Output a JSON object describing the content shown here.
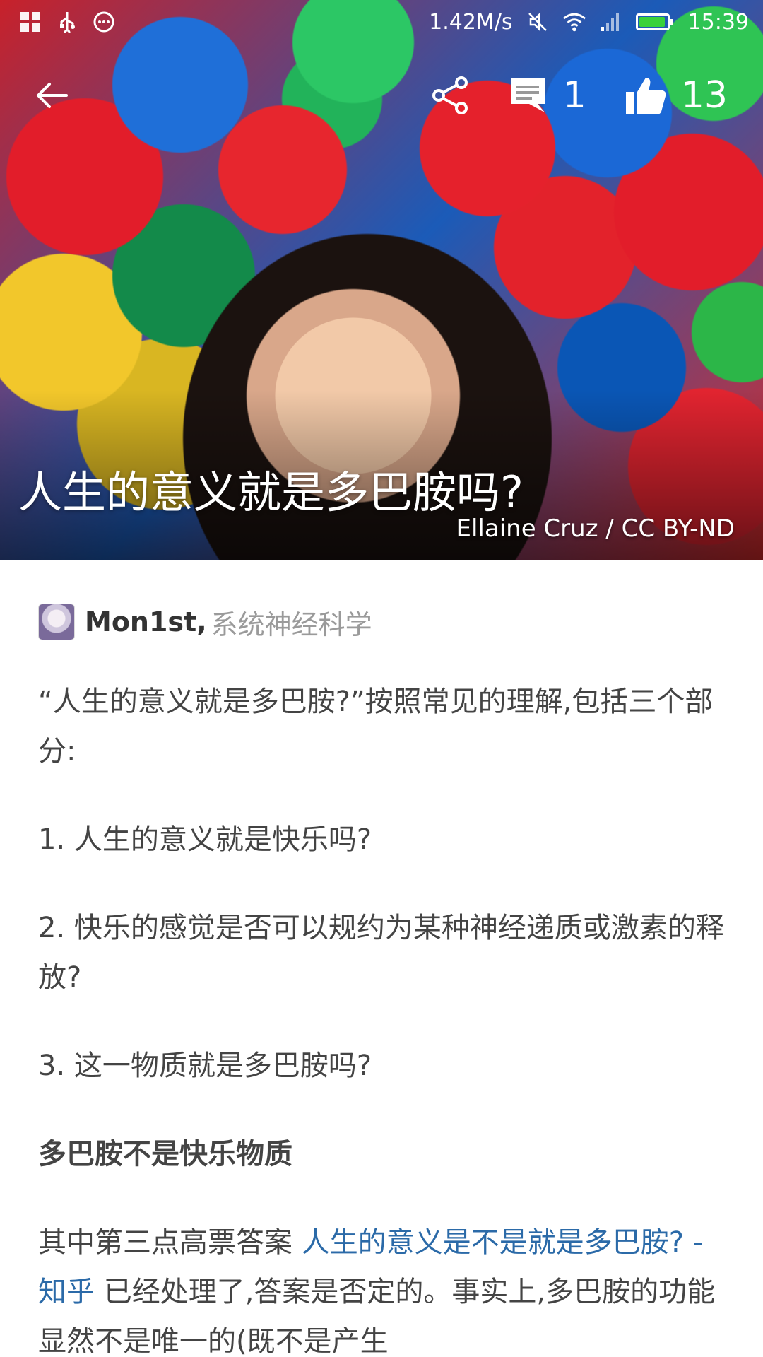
{
  "status_bar": {
    "speed": "1.42M/s",
    "time": "15:39"
  },
  "toolbar": {
    "comment_count": "1",
    "like_count": "13"
  },
  "hero": {
    "title": "人生的意义就是多巴胺吗?",
    "credit": "Ellaine Cruz / CC BY-ND"
  },
  "author": {
    "name": "Mon1st",
    "separator": ",",
    "bio": "系统神经科学"
  },
  "body": {
    "p1": "“人生的意义就是多巴胺?”按照常见的理解,包括三个部分:",
    "p2": "1. 人生的意义就是快乐吗?",
    "p3": "2. 快乐的感觉是否可以规约为某种神经递质或激素的释放?",
    "p4": "3. 这一物质就是多巴胺吗?",
    "heading": "多巴胺不是快乐物质",
    "p5_prefix": "其中第三点高票答案 ",
    "p5_link": "人生的意义是不是就是多巴胺? - 知乎",
    "p5_suffix": " 已经处理了,答案是否定的。事实上,多巴胺的功能显然不是唯一的(既不是产生"
  },
  "colors": {
    "link": "#2b6aa8",
    "body_text": "#444444",
    "bio_text": "#9a9a9a",
    "battery": "#3ad13a"
  }
}
